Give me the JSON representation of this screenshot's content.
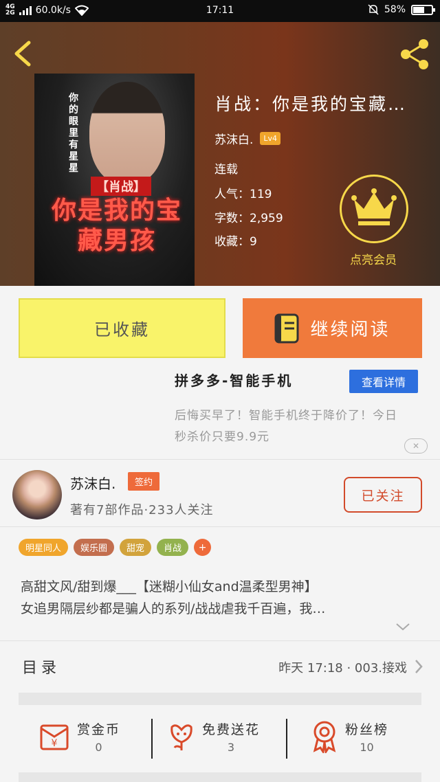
{
  "status_bar": {
    "network": "4G",
    "network2": "2G",
    "speed": "60.0k/s",
    "time": "17:11",
    "battery": "58%",
    "battery_level": 0.58
  },
  "book": {
    "title": "肖战：你是我的宝藏…",
    "author": "苏沫白.",
    "level": "Lv4",
    "status": "连载",
    "popularity": "人气：119",
    "word_count": "字数：2,959",
    "favorites": "收藏：9",
    "vip_label": "点亮会员",
    "cover": {
      "vertical_text": "你的眼里有星星",
      "tag": "【肖战】",
      "title": "你是我的宝藏男孩"
    }
  },
  "actions": {
    "favorited_label": "已收藏",
    "continue_label": "继续阅读"
  },
  "ad": {
    "title": "拼多多-智能手机",
    "button": "查看详情",
    "text": "后悔买早了！智能手机终于降价了！今日秒杀价只要9.9元"
  },
  "author_card": {
    "name": "苏沫白.",
    "badge": "签约",
    "stats": "著有7部作品·233人关注",
    "follow_label": "已关注"
  },
  "tags": [
    {
      "label": "明星同人",
      "color": "#f0a52c"
    },
    {
      "label": "娱乐圈",
      "color": "#c36e4e"
    },
    {
      "label": "甜宠",
      "color": "#d2a33c"
    },
    {
      "label": "肖战",
      "color": "#93b24e"
    }
  ],
  "tag_more": "+",
  "description": {
    "line1": "高甜文风/甜到爆___【迷糊小仙女and温柔型男神】",
    "line2": "女追男隔层纱都是骗人的系列/战战虐我千百遍，我…"
  },
  "toc": {
    "label": "目录",
    "latest": "昨天 17:18 · 003.接戏"
  },
  "bottom_stats": [
    {
      "label": "赏金币",
      "value": "0"
    },
    {
      "label": "免费送花",
      "value": "3"
    },
    {
      "label": "粉丝榜",
      "value": "10"
    }
  ],
  "colors": {
    "accent_orange": "#f07a3c",
    "favorite_yellow": "#f9f36a",
    "icon_red": "#d94a2a",
    "vip_gold": "#f7d84a",
    "ad_blue": "#2d6fde"
  }
}
